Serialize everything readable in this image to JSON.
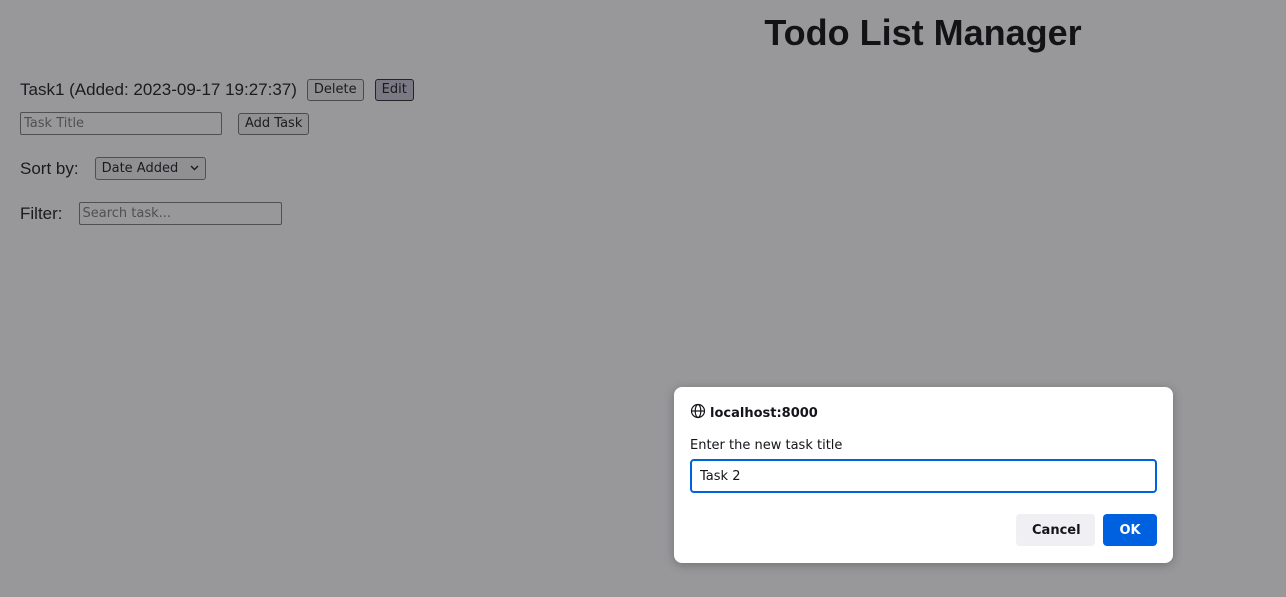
{
  "page": {
    "title": "Todo List Manager"
  },
  "tasks": [
    {
      "text": "Task1 (Added: 2023-09-17 19:27:37)",
      "delete_label": "Delete",
      "edit_label": "Edit"
    }
  ],
  "add_form": {
    "title_placeholder": "Task Title",
    "title_value": "",
    "add_label": "Add Task"
  },
  "sort": {
    "label": "Sort by:",
    "selected": "Date Added"
  },
  "filter": {
    "label": "Filter:",
    "placeholder": "Search task...",
    "value": ""
  },
  "dialog": {
    "origin": "localhost:8000",
    "message": "Enter the new task title",
    "input_value": "Task 2",
    "cancel_label": "Cancel",
    "ok_label": "OK",
    "origin_icon": "globe-icon"
  },
  "colors": {
    "overlay": "#28282d",
    "accent": "#0061e0"
  }
}
